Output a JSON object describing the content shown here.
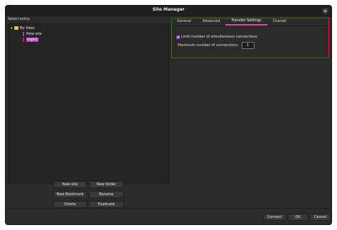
{
  "window": {
    "title": "Site Manager"
  },
  "left": {
    "select_label": "Select entry:",
    "tree": [
      {
        "label": "My Sites",
        "kind": "folder",
        "expanded": true
      },
      {
        "label": "New site",
        "kind": "site",
        "color": "#8e4ad6"
      },
      {
        "label": "login1",
        "kind": "site",
        "color": "#c2272d",
        "selected": true
      }
    ],
    "buttons": {
      "new_site": "New site",
      "new_folder": "New folder",
      "new_bookmark": "New Bookmark",
      "rename": "Rename",
      "delete": "Delete",
      "duplicate": "Duplicate"
    }
  },
  "tabs": [
    {
      "label": "General",
      "active": false
    },
    {
      "label": "Advanced",
      "active": false
    },
    {
      "label": "Transfer Settings",
      "active": true
    },
    {
      "label": "Charset",
      "active": false
    }
  ],
  "transfer": {
    "limit_checkbox_label": "Limit number of simultaneous connections",
    "limit_checked": true,
    "max_label": "Maximum number of connections:",
    "max_value": "1"
  },
  "footer": {
    "connect": "Connect",
    "ok": "OK",
    "cancel": "Cancel"
  },
  "colors": {
    "accent": "#d84f9e",
    "selection": "#b443c9",
    "highlight_box": "#d11f2a"
  }
}
